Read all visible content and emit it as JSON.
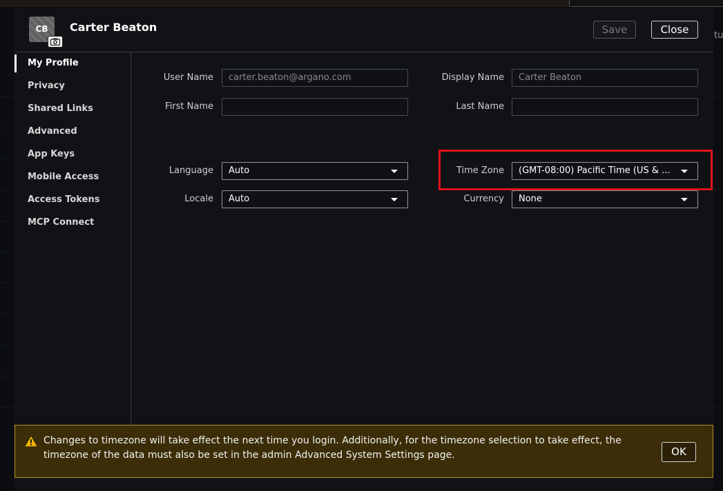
{
  "background": {
    "side_text": "tu"
  },
  "dialog": {
    "avatar_initials": "CB",
    "title": "Carter Beaton",
    "save_label": "Save",
    "close_label": "Close"
  },
  "sidebar": {
    "items": [
      {
        "label": "My Profile",
        "active": true
      },
      {
        "label": "Privacy"
      },
      {
        "label": "Shared Links"
      },
      {
        "label": "Advanced"
      },
      {
        "label": "App Keys"
      },
      {
        "label": "Mobile Access"
      },
      {
        "label": "Access Tokens"
      },
      {
        "label": "MCP Connect"
      }
    ]
  },
  "form": {
    "user_name": {
      "label": "User Name",
      "value": "carter.beaton@argano.com"
    },
    "display_name": {
      "label": "Display Name",
      "value": "Carter Beaton"
    },
    "first_name": {
      "label": "First Name",
      "value": ""
    },
    "last_name": {
      "label": "Last Name",
      "value": ""
    },
    "language": {
      "label": "Language",
      "value": "Auto"
    },
    "time_zone": {
      "label": "Time Zone",
      "value": "(GMT-08:00) Pacific Time (US & ..."
    },
    "locale": {
      "label": "Locale",
      "value": "Auto"
    },
    "currency": {
      "label": "Currency",
      "value": "None"
    }
  },
  "banner": {
    "message": "Changes to timezone will take effect the next time you login. Additionally, for the timezone selection to take effect, the timezone of the data must also be set in the admin Advanced System Settings page.",
    "ok_label": "OK"
  },
  "colors": {
    "highlight": "#e0121b",
    "banner_bg": "#3b2d07",
    "banner_border": "#b3922a",
    "warning": "#f5b400"
  }
}
